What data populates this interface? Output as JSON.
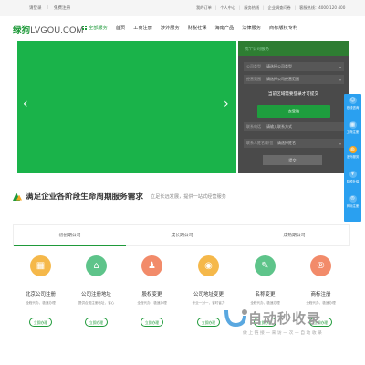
{
  "topbar": {
    "left_links": [
      "请登录",
      "免费注册"
    ],
    "right_links": [
      "我的订单",
      "个人中心",
      "服务热线",
      "企业调查问卷",
      "客服热线：4000 120 400"
    ]
  },
  "header": {
    "logo_brand": "绿狗",
    "logo_domain": "LVGOU.COM",
    "nav_all": "全部服务",
    "nav_items": [
      "首页",
      "工商注册",
      "涉外服务",
      "财税社保",
      "海南产品",
      "法律服务",
      "商标版权专利"
    ]
  },
  "banner": {
    "color": "#1ab34a",
    "prev_label": "‹",
    "next_label": "›"
  },
  "form_panel": {
    "header": "找个公司服务",
    "rows": [
      {
        "key": "公司类型",
        "value": "请选择公司类型"
      },
      {
        "key": "经营范围",
        "value": "请选择公司经营范围"
      },
      {
        "key": "公司名称",
        "value": "请输入公司名称"
      }
    ],
    "notice": "当前区域需要登录才可提交",
    "login_label": "去登陆",
    "extra_row": {
      "key": "联系电话",
      "value": "请输入联系方式"
    },
    "last_row": {
      "key": "联系人姓名/职位",
      "value": "请选择姓名"
    },
    "submit_label": "提交"
  },
  "sidebar": {
    "items": [
      {
        "label": "在线咨询",
        "icon": "chat-icon"
      },
      {
        "label": "工商注册",
        "icon": "building-icon"
      },
      {
        "label": "涉外服务",
        "icon": "globe-icon"
      },
      {
        "label": "财税社保",
        "icon": "tax-icon"
      },
      {
        "label": "商标注册",
        "icon": "trademark-icon"
      }
    ]
  },
  "section": {
    "title": "满足企业各阶段生命周期服务需求",
    "subtitle": "立足长远发展，提供一站式经营服务"
  },
  "tabs": [
    "初创期公司",
    "成长期公司",
    "成熟期公司"
  ],
  "cards": [
    {
      "title": "北京公司注册",
      "desc": "全程代办，极速办理",
      "button": "立即办理",
      "color": "#f5b84a",
      "icon": "building-icon",
      "glyph": "▦"
    },
    {
      "title": "公司注册地址",
      "desc": "提供合规注册地址，省心",
      "button": "立即办理",
      "color": "#5ec48a",
      "icon": "location-icon",
      "glyph": "⌂"
    },
    {
      "title": "股权变更",
      "desc": "全程代办，极速办理",
      "button": "立即办理",
      "color": "#f28b6a",
      "icon": "person-icon",
      "glyph": "♟"
    },
    {
      "title": "公司地址变更",
      "desc": "专业一对一，省时省力",
      "button": "立即办理",
      "color": "#f5b84a",
      "icon": "pin-icon",
      "glyph": "◉"
    },
    {
      "title": "名称变更",
      "desc": "全程代办，极速办理",
      "button": "立即办理",
      "color": "#5ec48a",
      "icon": "edit-icon",
      "glyph": "✎"
    },
    {
      "title": "商标注册",
      "desc": "全程代办，极速办理",
      "button": "立即办理",
      "color": "#f28b6a",
      "icon": "registered-icon",
      "glyph": "®"
    }
  ],
  "watermark": {
    "title": "自动秒收录",
    "subtitle": "做 上 链 接 — 来 访 一 次 — 自 动 收 录"
  },
  "colors": {
    "brand_green": "#1f9a3a",
    "sidebar_blue": "#2aa0f0",
    "accent_orange": "#f5a623"
  }
}
